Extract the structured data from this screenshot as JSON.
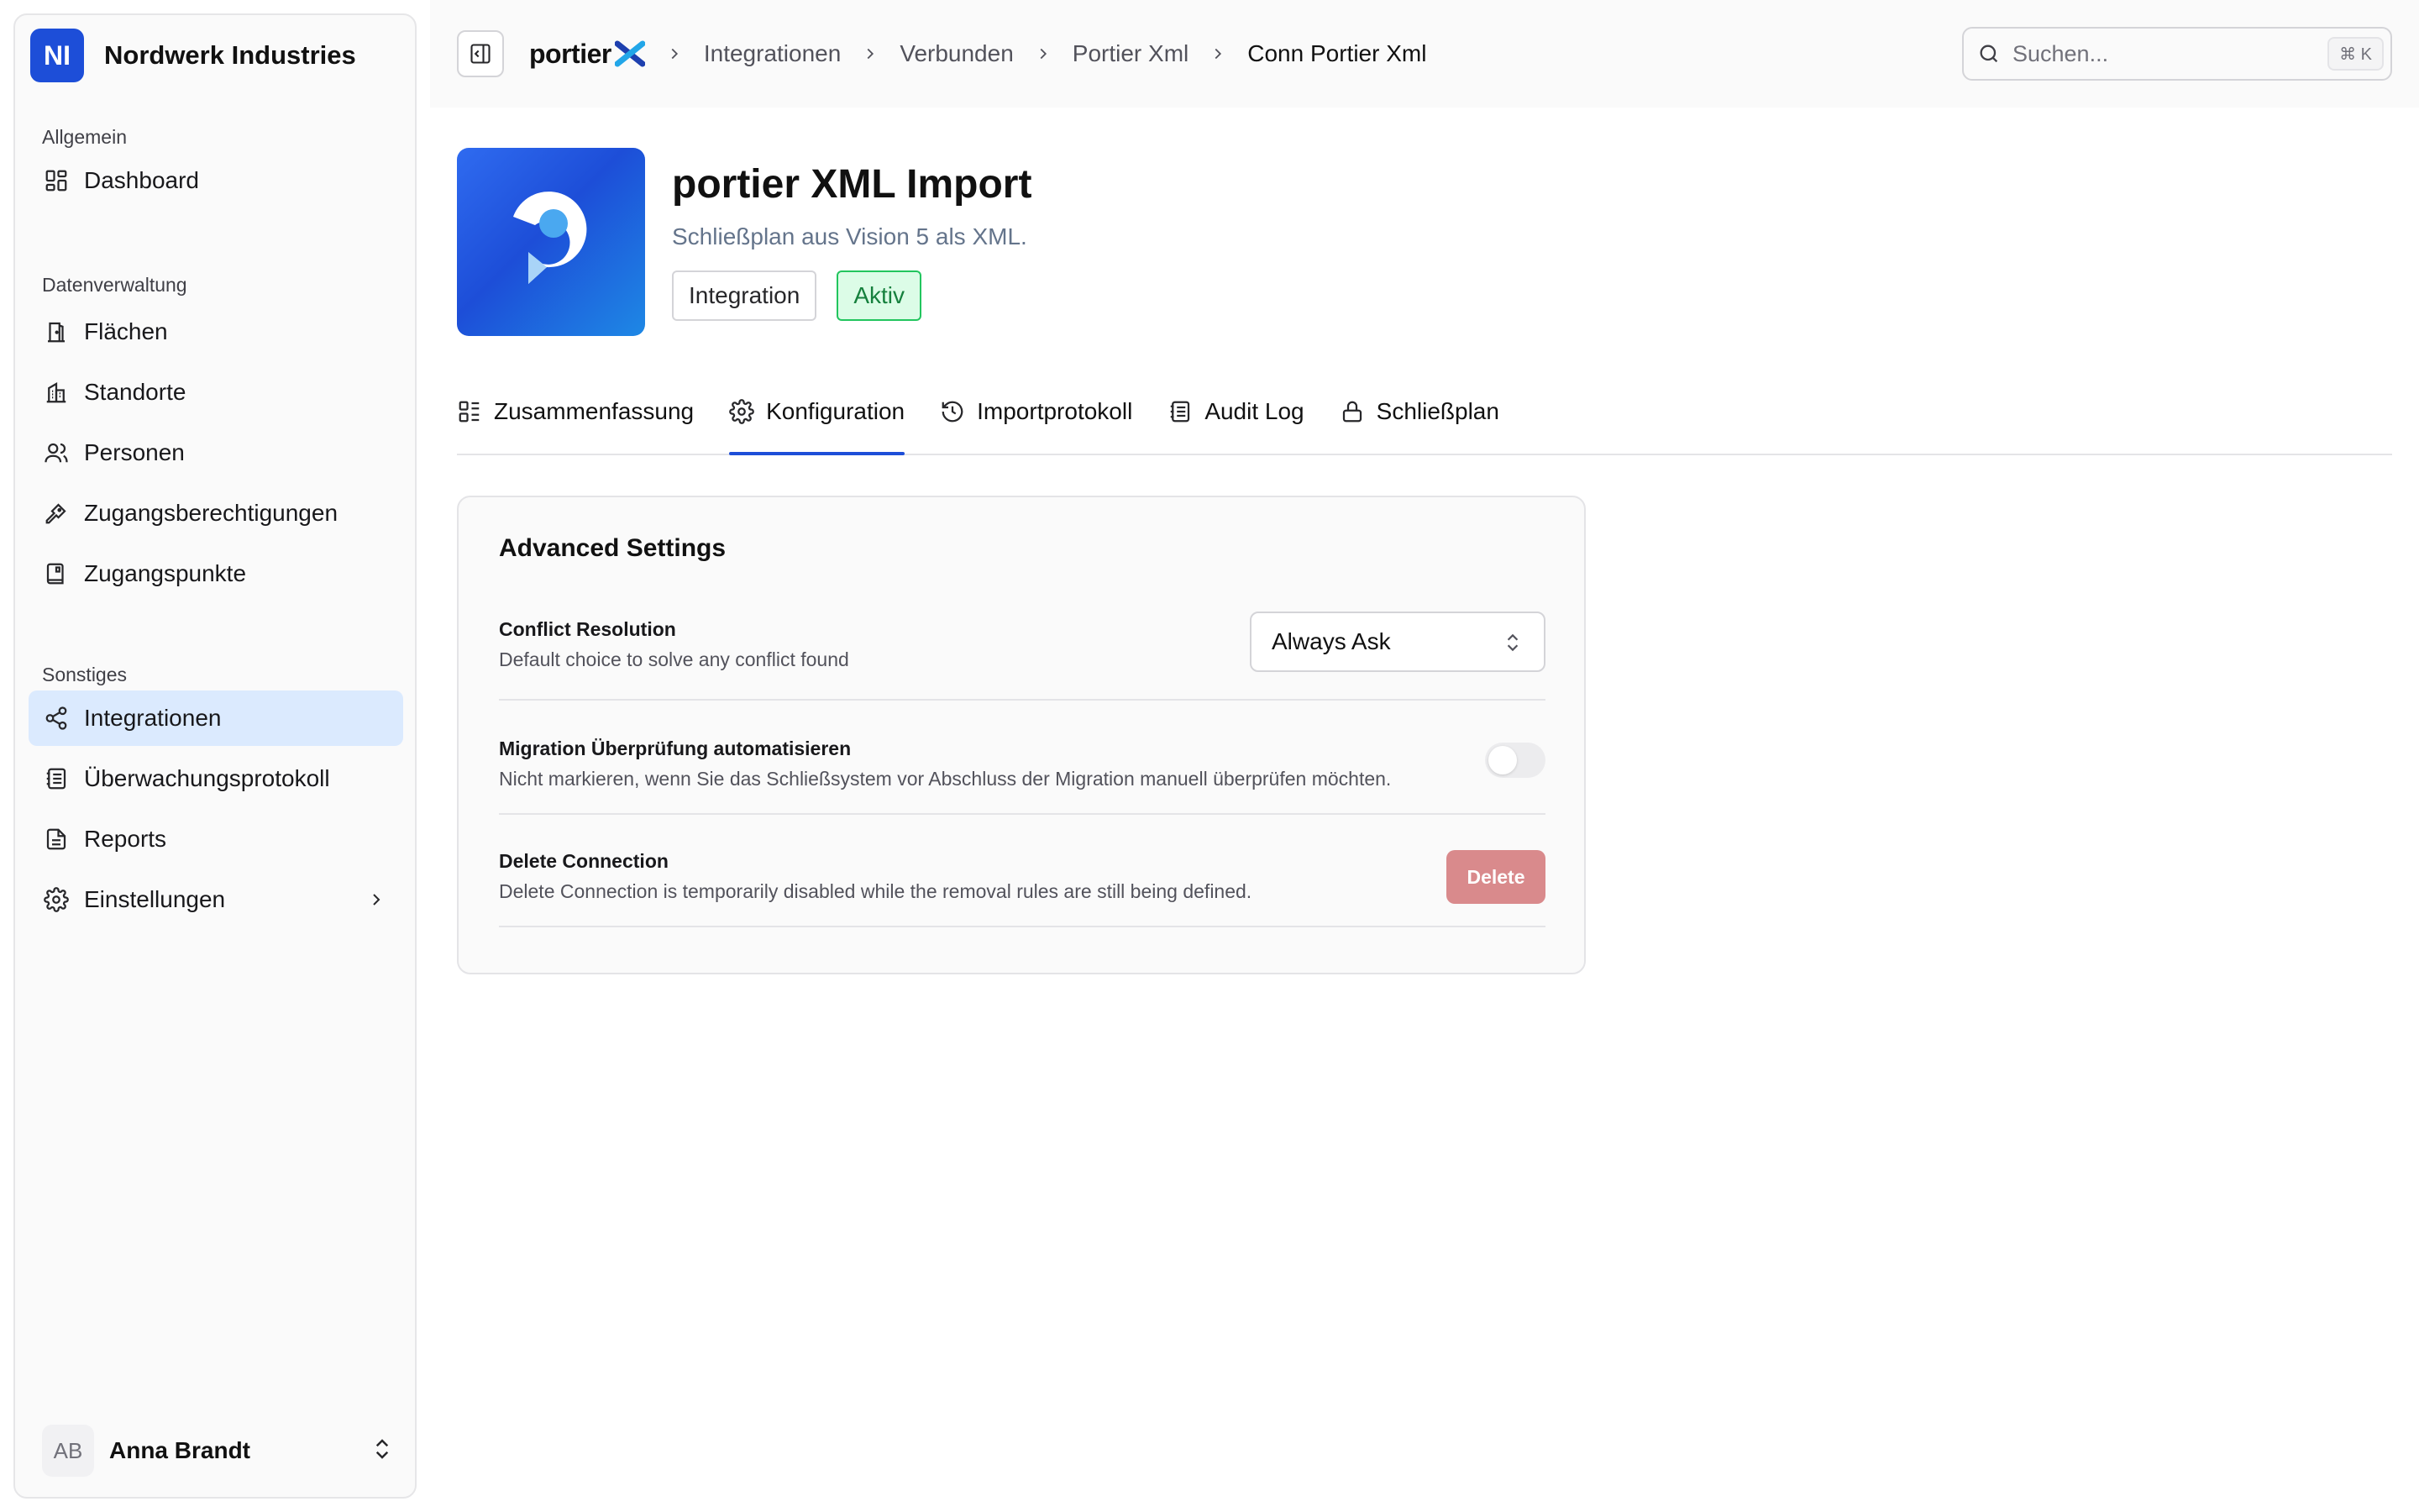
{
  "org": {
    "initials": "NI",
    "name": "Nordwerk Industries",
    "logo_color": "#1d4ed8"
  },
  "sidebar": {
    "groups": [
      {
        "label": "Allgemein",
        "items": [
          {
            "label": "Dashboard",
            "icon": "dashboard-icon"
          }
        ]
      },
      {
        "label": "Datenverwaltung",
        "items": [
          {
            "label": "Flächen",
            "icon": "door-icon"
          },
          {
            "label": "Standorte",
            "icon": "building-icon"
          },
          {
            "label": "Personen",
            "icon": "users-icon"
          },
          {
            "label": "Zugangsberechtigungen",
            "icon": "key-icon"
          },
          {
            "label": "Zugangspunkte",
            "icon": "reader-icon"
          }
        ]
      },
      {
        "label": "Sonstiges",
        "items": [
          {
            "label": "Integrationen",
            "icon": "share-icon",
            "active": true
          },
          {
            "label": "Überwachungsprotokoll",
            "icon": "log-icon"
          },
          {
            "label": "Reports",
            "icon": "report-icon"
          },
          {
            "label": "Einstellungen",
            "icon": "gear-icon"
          }
        ]
      }
    ],
    "active_color": "#dbeafe"
  },
  "user": {
    "initials": "AB",
    "name": "Anna Brandt"
  },
  "header": {
    "brand": "portier",
    "breadcrumbs": [
      "Integrationen",
      "Verbunden",
      "Portier Xml",
      "Conn Portier Xml"
    ],
    "search_placeholder": "Suchen...",
    "search_shortcut": "⌘ K"
  },
  "integration": {
    "title": "portier XML Import",
    "subtitle": "Schließplan aus Vision 5 als XML.",
    "badges": [
      "Integration",
      "Aktiv"
    ],
    "status_color": "#15803d"
  },
  "tabs": [
    {
      "label": "Zusammenfassung",
      "icon": "summary-icon"
    },
    {
      "label": "Konfiguration",
      "icon": "gear-icon",
      "selected": true
    },
    {
      "label": "Importprotokoll",
      "icon": "history-icon"
    },
    {
      "label": "Audit Log",
      "icon": "log-icon"
    },
    {
      "label": "Schließplan",
      "icon": "lock-icon"
    }
  ],
  "settings": {
    "title": "Advanced Settings",
    "conflict": {
      "label": "Conflict Resolution",
      "description": "Default choice to solve any conflict found",
      "value": "Always Ask"
    },
    "migration": {
      "label": "Migration Überprüfung automatisieren",
      "description": "Nicht markieren, wenn Sie das Schließsystem vor Abschluss der Migration manuell überprüfen möchten.",
      "enabled": false
    },
    "delete": {
      "label": "Delete Connection",
      "description": "Delete Connection is temporarily disabled while the removal rules are still being defined.",
      "button": "Delete",
      "button_color": "#d98a8c"
    }
  }
}
